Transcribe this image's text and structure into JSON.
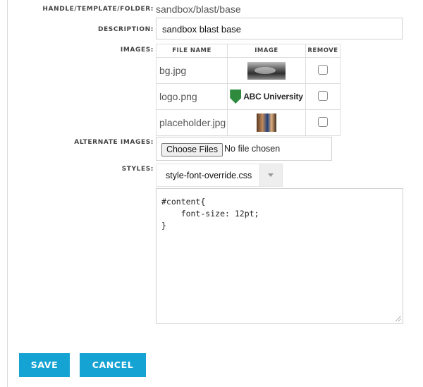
{
  "form": {
    "handle_label": "HANDLE/TEMPLATE/FOLDER:",
    "handle_value": "sandbox/blast/base",
    "description_label": "DESCRIPTION:",
    "description_value": "sandbox blast base",
    "images_label": "IMAGES:",
    "alternate_images_label": "ALTERNATE IMAGES:",
    "styles_label": "STYLES:"
  },
  "images_table": {
    "headers": [
      "FILE NAME",
      "IMAGE",
      "REMOVE"
    ],
    "rows": [
      {
        "file_name": "bg.jpg",
        "remove_checked": false
      },
      {
        "file_name": "logo.png",
        "logo_text": "ABC University",
        "remove_checked": false
      },
      {
        "file_name": "placeholder.jpg",
        "remove_checked": false
      }
    ]
  },
  "file_input": {
    "button_label": "Choose Files",
    "status": "No file chosen"
  },
  "styles": {
    "selected": "style-font-override.css",
    "code_lines": [
      "#content{",
      "    font-size: 12pt;",
      "}"
    ]
  },
  "actions": {
    "save_label": "SAVE",
    "cancel_label": "CANCEL"
  },
  "colors": {
    "button_bg": "#15a3d4",
    "logo_green": "#2e8b3e"
  }
}
